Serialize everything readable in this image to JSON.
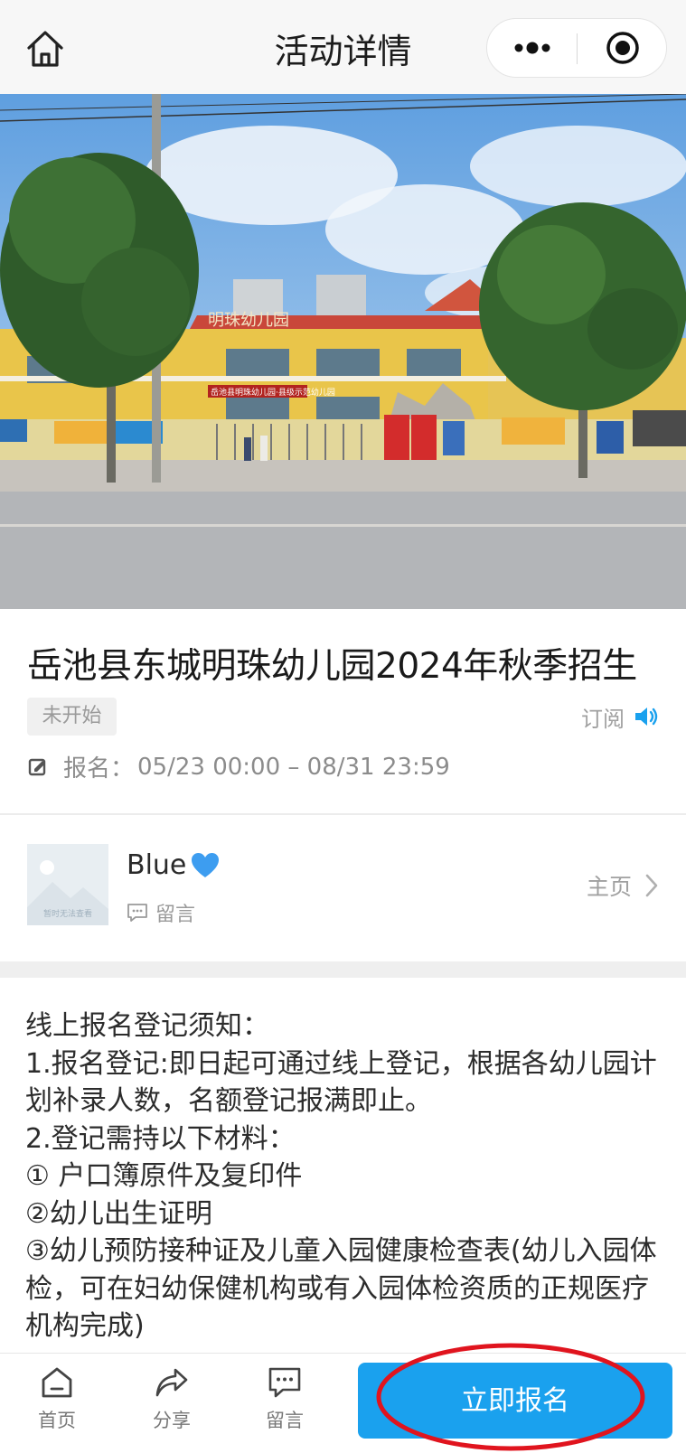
{
  "header": {
    "title": "活动详情",
    "home_icon": "home-icon",
    "more_icon": "more-dots-icon",
    "close_icon": "target-close-icon"
  },
  "hero": {
    "sign_text": "明珠幼儿园",
    "banner_text": "岳池县明珠幼儿园·县级示范幼儿园"
  },
  "event": {
    "title": "岳池县东城明珠幼儿园2024年秋季招生",
    "status": "未开始",
    "subscribe_label": "订阅",
    "registration_label": "报名：",
    "registration_time": "05/23 00:00 – 08/31 23:59"
  },
  "organizer": {
    "name": "Blue",
    "avatar_caption": "暂时无法查看",
    "message_label": "留言",
    "homepage_label": "主页"
  },
  "notice": {
    "lines": [
      "线上报名登记须知：",
      "1.报名登记:即日起可通过线上登记，根据各幼儿园计划补录人数，名额登记报满即止。",
      "2.登记需持以下材料：",
      "① 户口簿原件及复印件",
      "②幼儿出生证明",
      "③幼儿预防接种证及儿童入园健康检查表(幼儿入园体检，可在妇幼保健机构或有入园体检资质的正规医疗机构完成)"
    ]
  },
  "tabbar": {
    "home_label": "首页",
    "share_label": "分享",
    "message_label": "留言",
    "signup_label": "立即报名"
  },
  "colors": {
    "accent": "#1aa1ee",
    "annotation_red": "#e0141e"
  }
}
